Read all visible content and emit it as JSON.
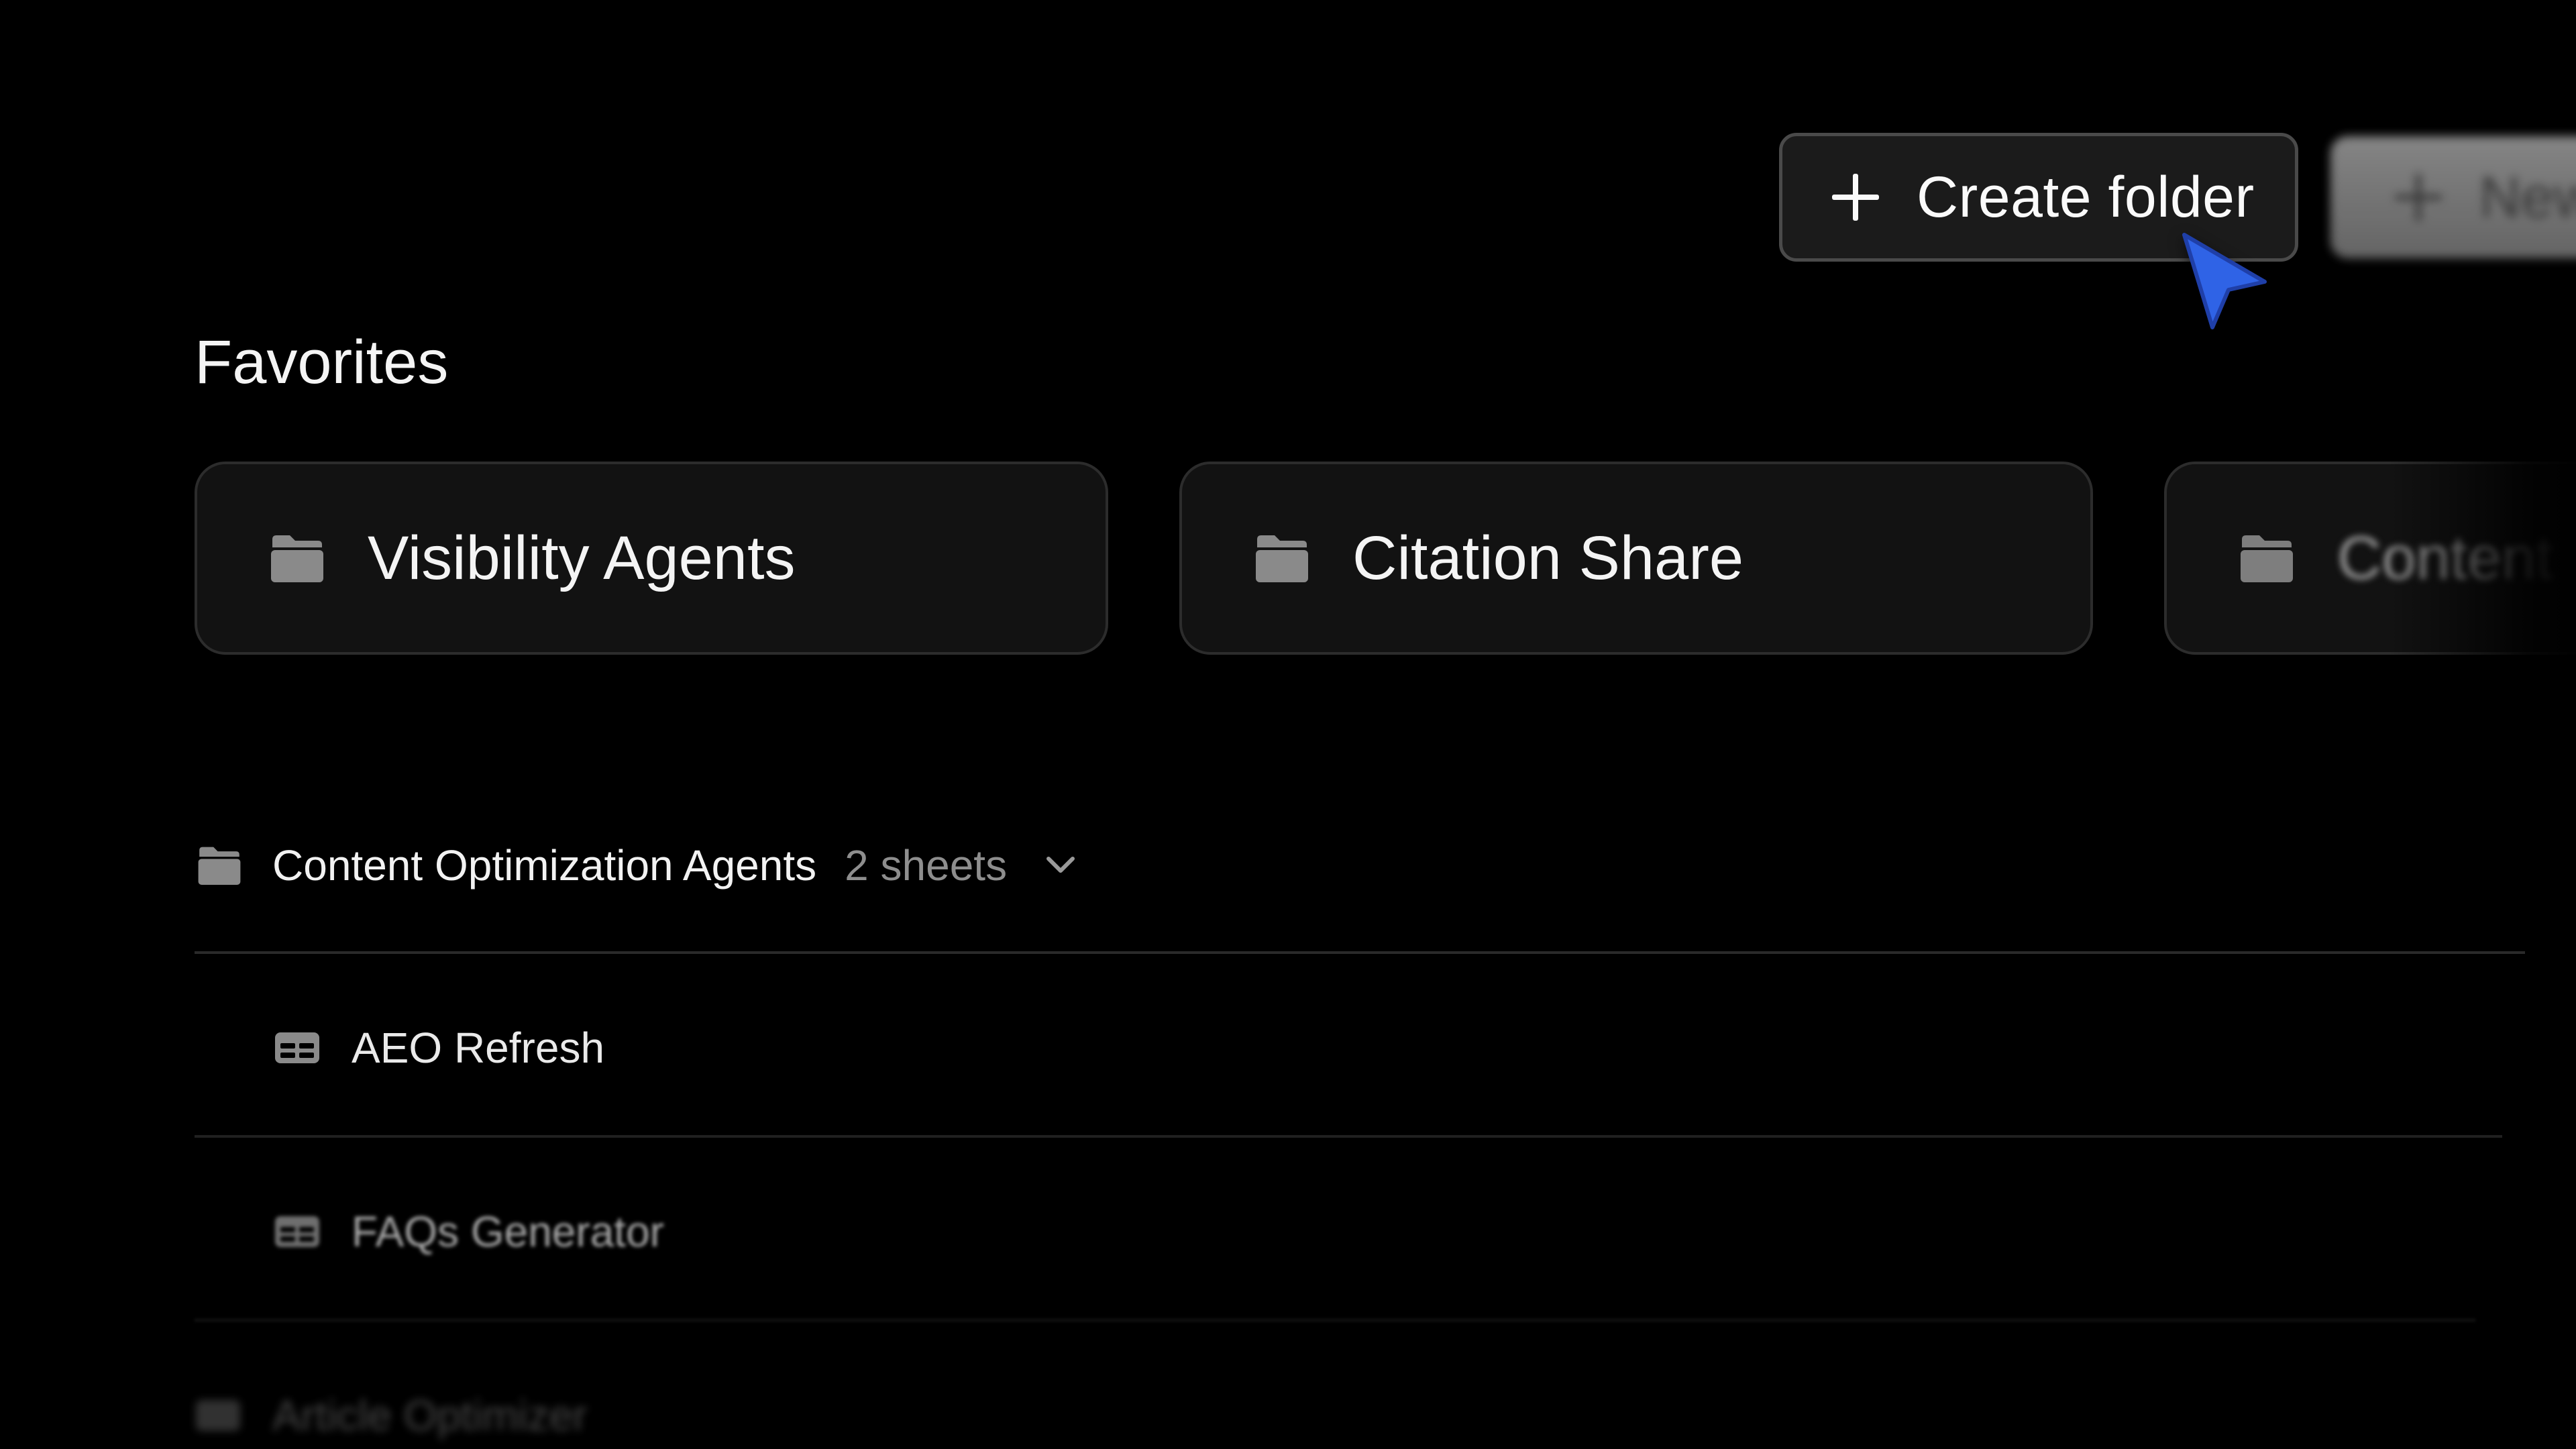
{
  "header": {
    "create_folder_label": "Create folder",
    "new_label": "New",
    "plus_icon": "plus-icon"
  },
  "favorites": {
    "title": "Favorites",
    "items": [
      {
        "label": "Visibility Agents",
        "icon": "folder-icon"
      },
      {
        "label": "Citation Share",
        "icon": "folder-icon"
      },
      {
        "label": "Content",
        "icon": "folder-icon"
      }
    ]
  },
  "folder_group": {
    "name": "Content Optimization Agents",
    "count": "2 sheets",
    "icon": "folder-icon",
    "toggle_icon": "chevron-down-icon",
    "sheets": [
      {
        "label": "AEO Refresh",
        "icon": "table-icon"
      },
      {
        "label": "FAQs Generator",
        "icon": "table-icon"
      },
      {
        "label": "Article Optimizer",
        "icon": "table-icon"
      }
    ]
  },
  "colors": {
    "background": "#000000",
    "card": "#121212",
    "cursor": "#2f63e6",
    "icon_gray": "#8a8a8a"
  }
}
